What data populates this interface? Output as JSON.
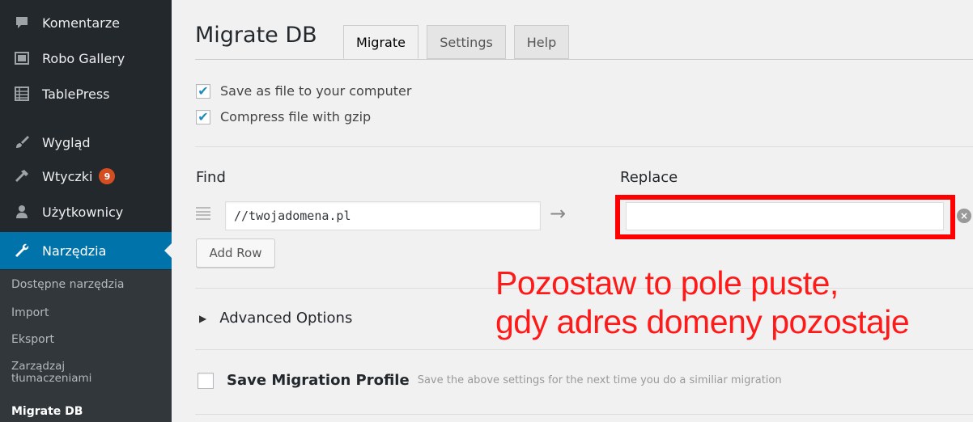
{
  "sidebar": {
    "items": [
      {
        "label": "Komentarze",
        "icon": "comment-icon"
      },
      {
        "label": "Robo Gallery",
        "icon": "gallery-icon"
      },
      {
        "label": "TablePress",
        "icon": "table-icon"
      },
      {
        "label": "Wygląd",
        "icon": "brush-icon"
      },
      {
        "label": "Wtyczki",
        "icon": "plugin-icon",
        "badge": "9"
      },
      {
        "label": "Użytkownicy",
        "icon": "user-icon"
      },
      {
        "label": "Narzędzia",
        "icon": "wrench-icon"
      }
    ],
    "submenu": [
      {
        "label": "Dostępne narzędzia"
      },
      {
        "label": "Import"
      },
      {
        "label": "Eksport"
      },
      {
        "label_line1": "Zarządzaj",
        "label_line2": "tłumaczeniami"
      },
      {
        "label": "Migrate DB"
      }
    ]
  },
  "page": {
    "title": "Migrate DB",
    "tabs": [
      {
        "label": "Migrate"
      },
      {
        "label": "Settings"
      },
      {
        "label": "Help"
      }
    ]
  },
  "options": {
    "save_as_file": {
      "label": "Save as file to your computer",
      "checked": true
    },
    "compress_gzip": {
      "label": "Compress file with gzip",
      "checked": true
    }
  },
  "find_replace": {
    "find_label": "Find",
    "replace_label": "Replace",
    "find_value": "//twojadomena.pl",
    "replace_value": "",
    "add_row_label": "Add Row"
  },
  "annotation": {
    "line1": "Pozostaw to pole puste,",
    "line2": "gdy adres domeny pozostaje"
  },
  "advanced": {
    "label": "Advanced Options"
  },
  "save_profile": {
    "title": "Save Migration Profile",
    "description": "Save the above settings for the next time you do a similiar migration"
  },
  "colors": {
    "sidebar_bg": "#23282d",
    "active_bg": "#0073aa",
    "badge_bg": "#d54e21",
    "annotation": "#ff1a1a",
    "highlight": "#ff0000",
    "checkmark": "#1e8cbe"
  }
}
